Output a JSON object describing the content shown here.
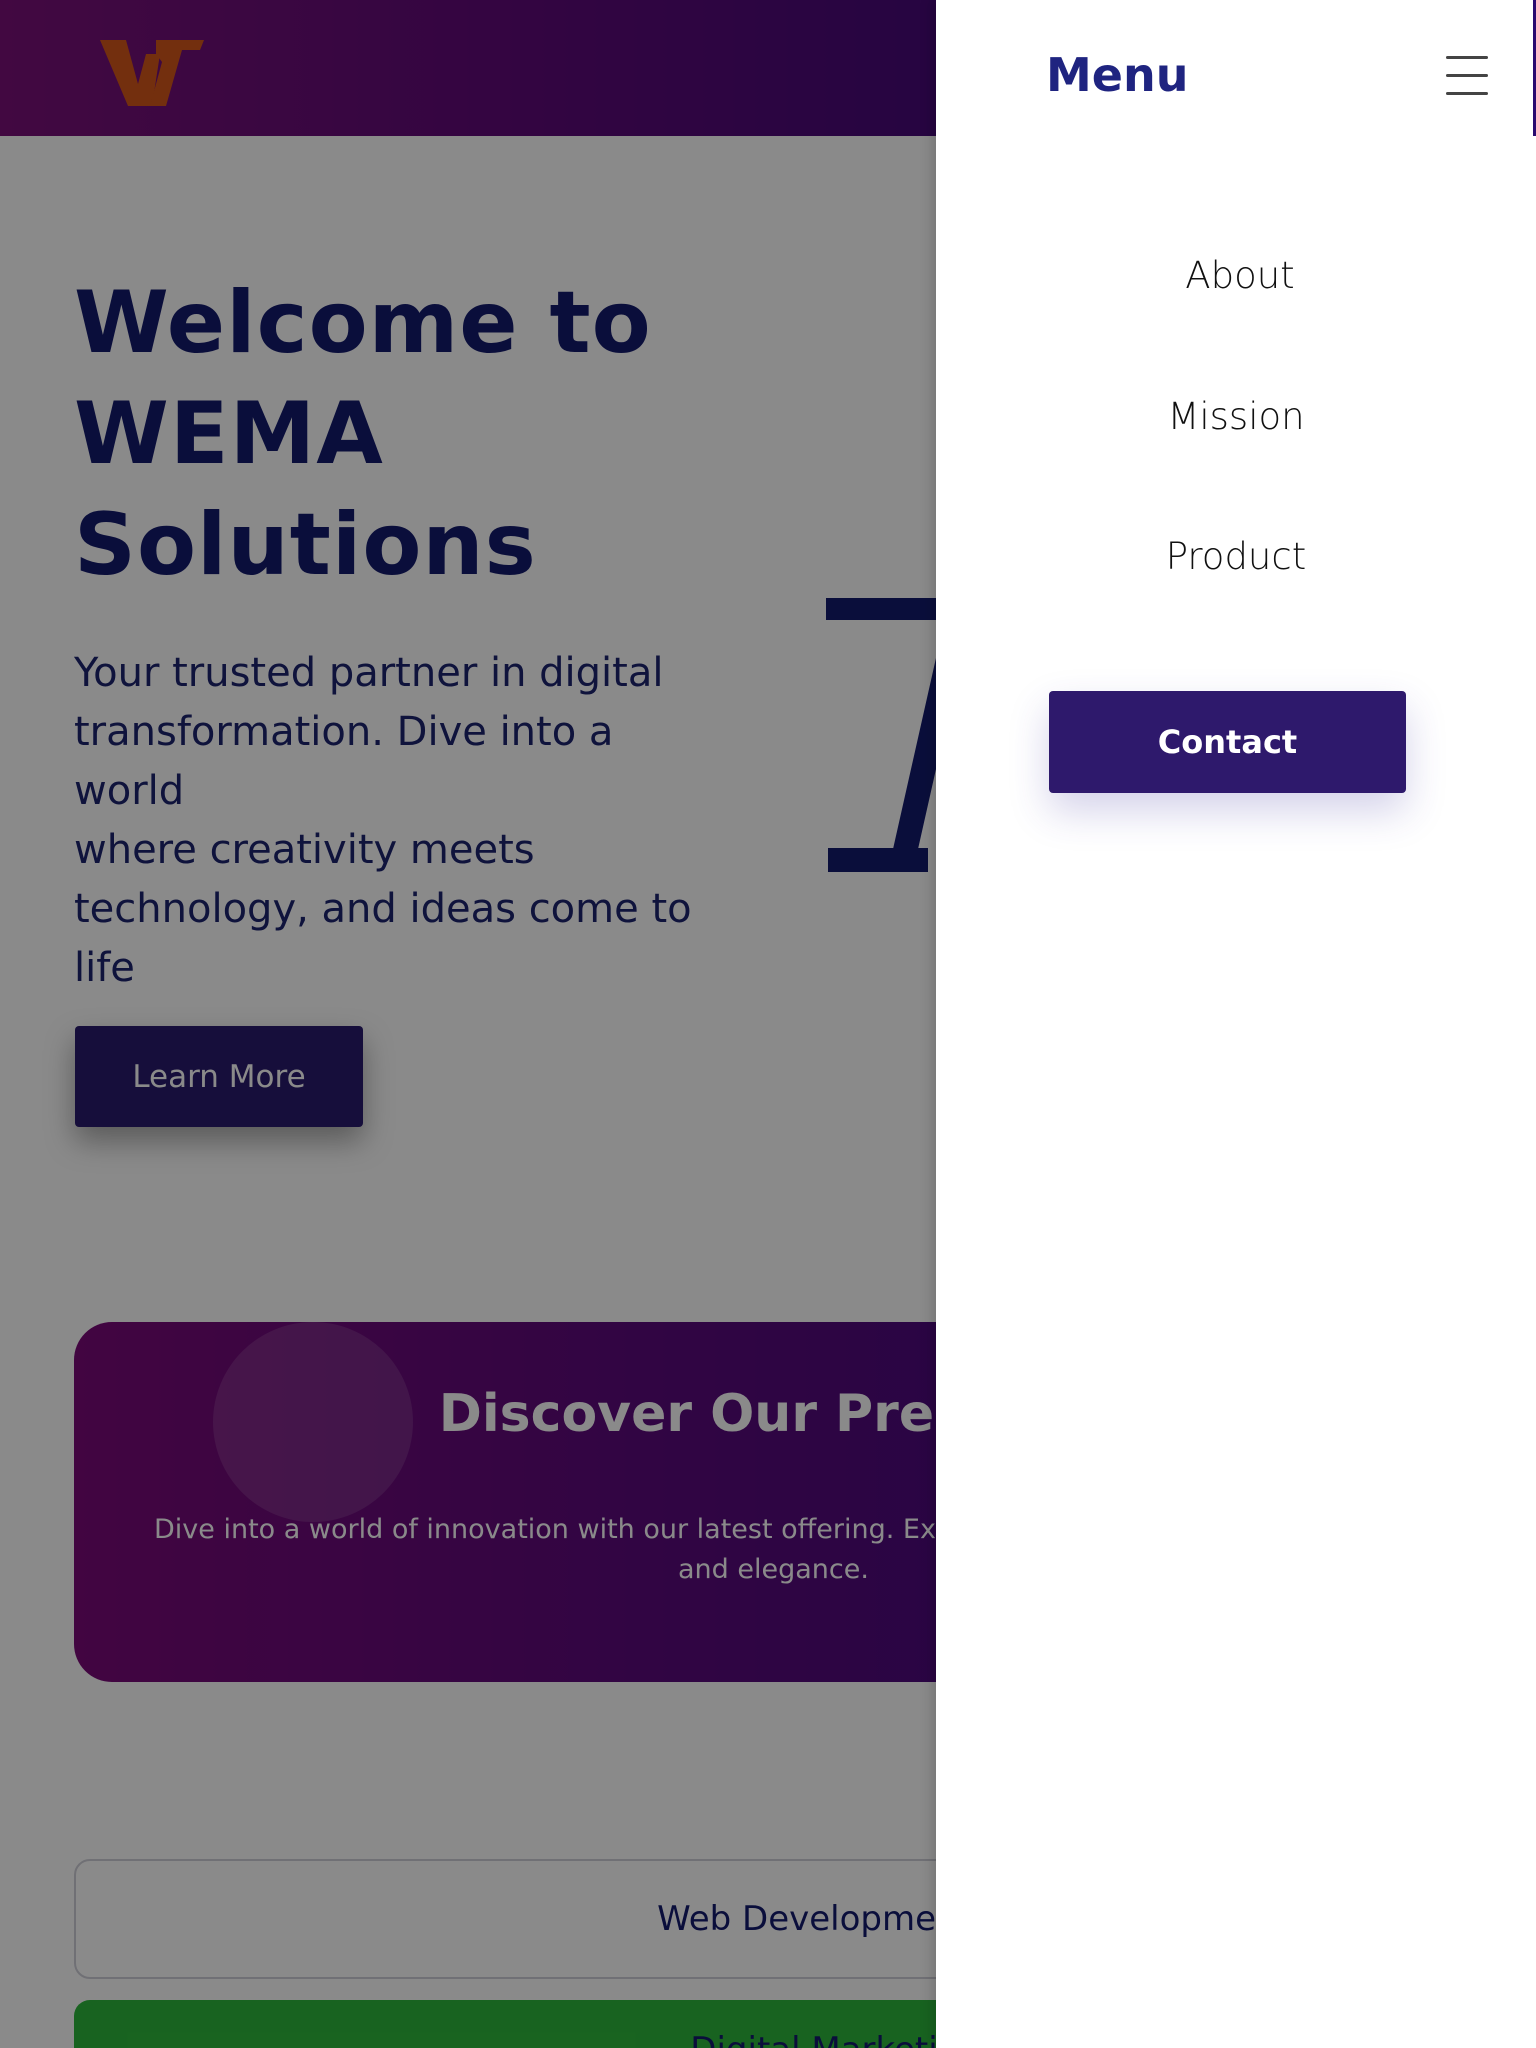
{
  "header": {
    "logo": "wema-logo-mark",
    "gradient_colors": [
      "#7a1078",
      "#2a0a70"
    ],
    "logo_color": "#d4571a"
  },
  "hero": {
    "title_lines": [
      "Welcome to",
      "WEMA",
      "Solutions"
    ],
    "text_lines": [
      "Your trusted partner in digital",
      "transformation. Dive into a world",
      "where creativity meets",
      "technology, and ideas come to",
      "life"
    ],
    "cta_label": "Learn More"
  },
  "promo": {
    "title": "Discover Our Premium",
    "text_line1": "Dive into a world of innovation with our latest offering. Experi",
    "text_line2": "and elegance."
  },
  "services": {
    "items": [
      "Web Development",
      "Digital Marketi"
    ]
  },
  "drawer": {
    "title": "Menu",
    "menu_icon": "hamburger-icon",
    "items": [
      {
        "label": "About"
      },
      {
        "label": "Mission"
      },
      {
        "label": "Product"
      }
    ],
    "contact_label": "Contact",
    "accent_color": "#2e196c"
  }
}
